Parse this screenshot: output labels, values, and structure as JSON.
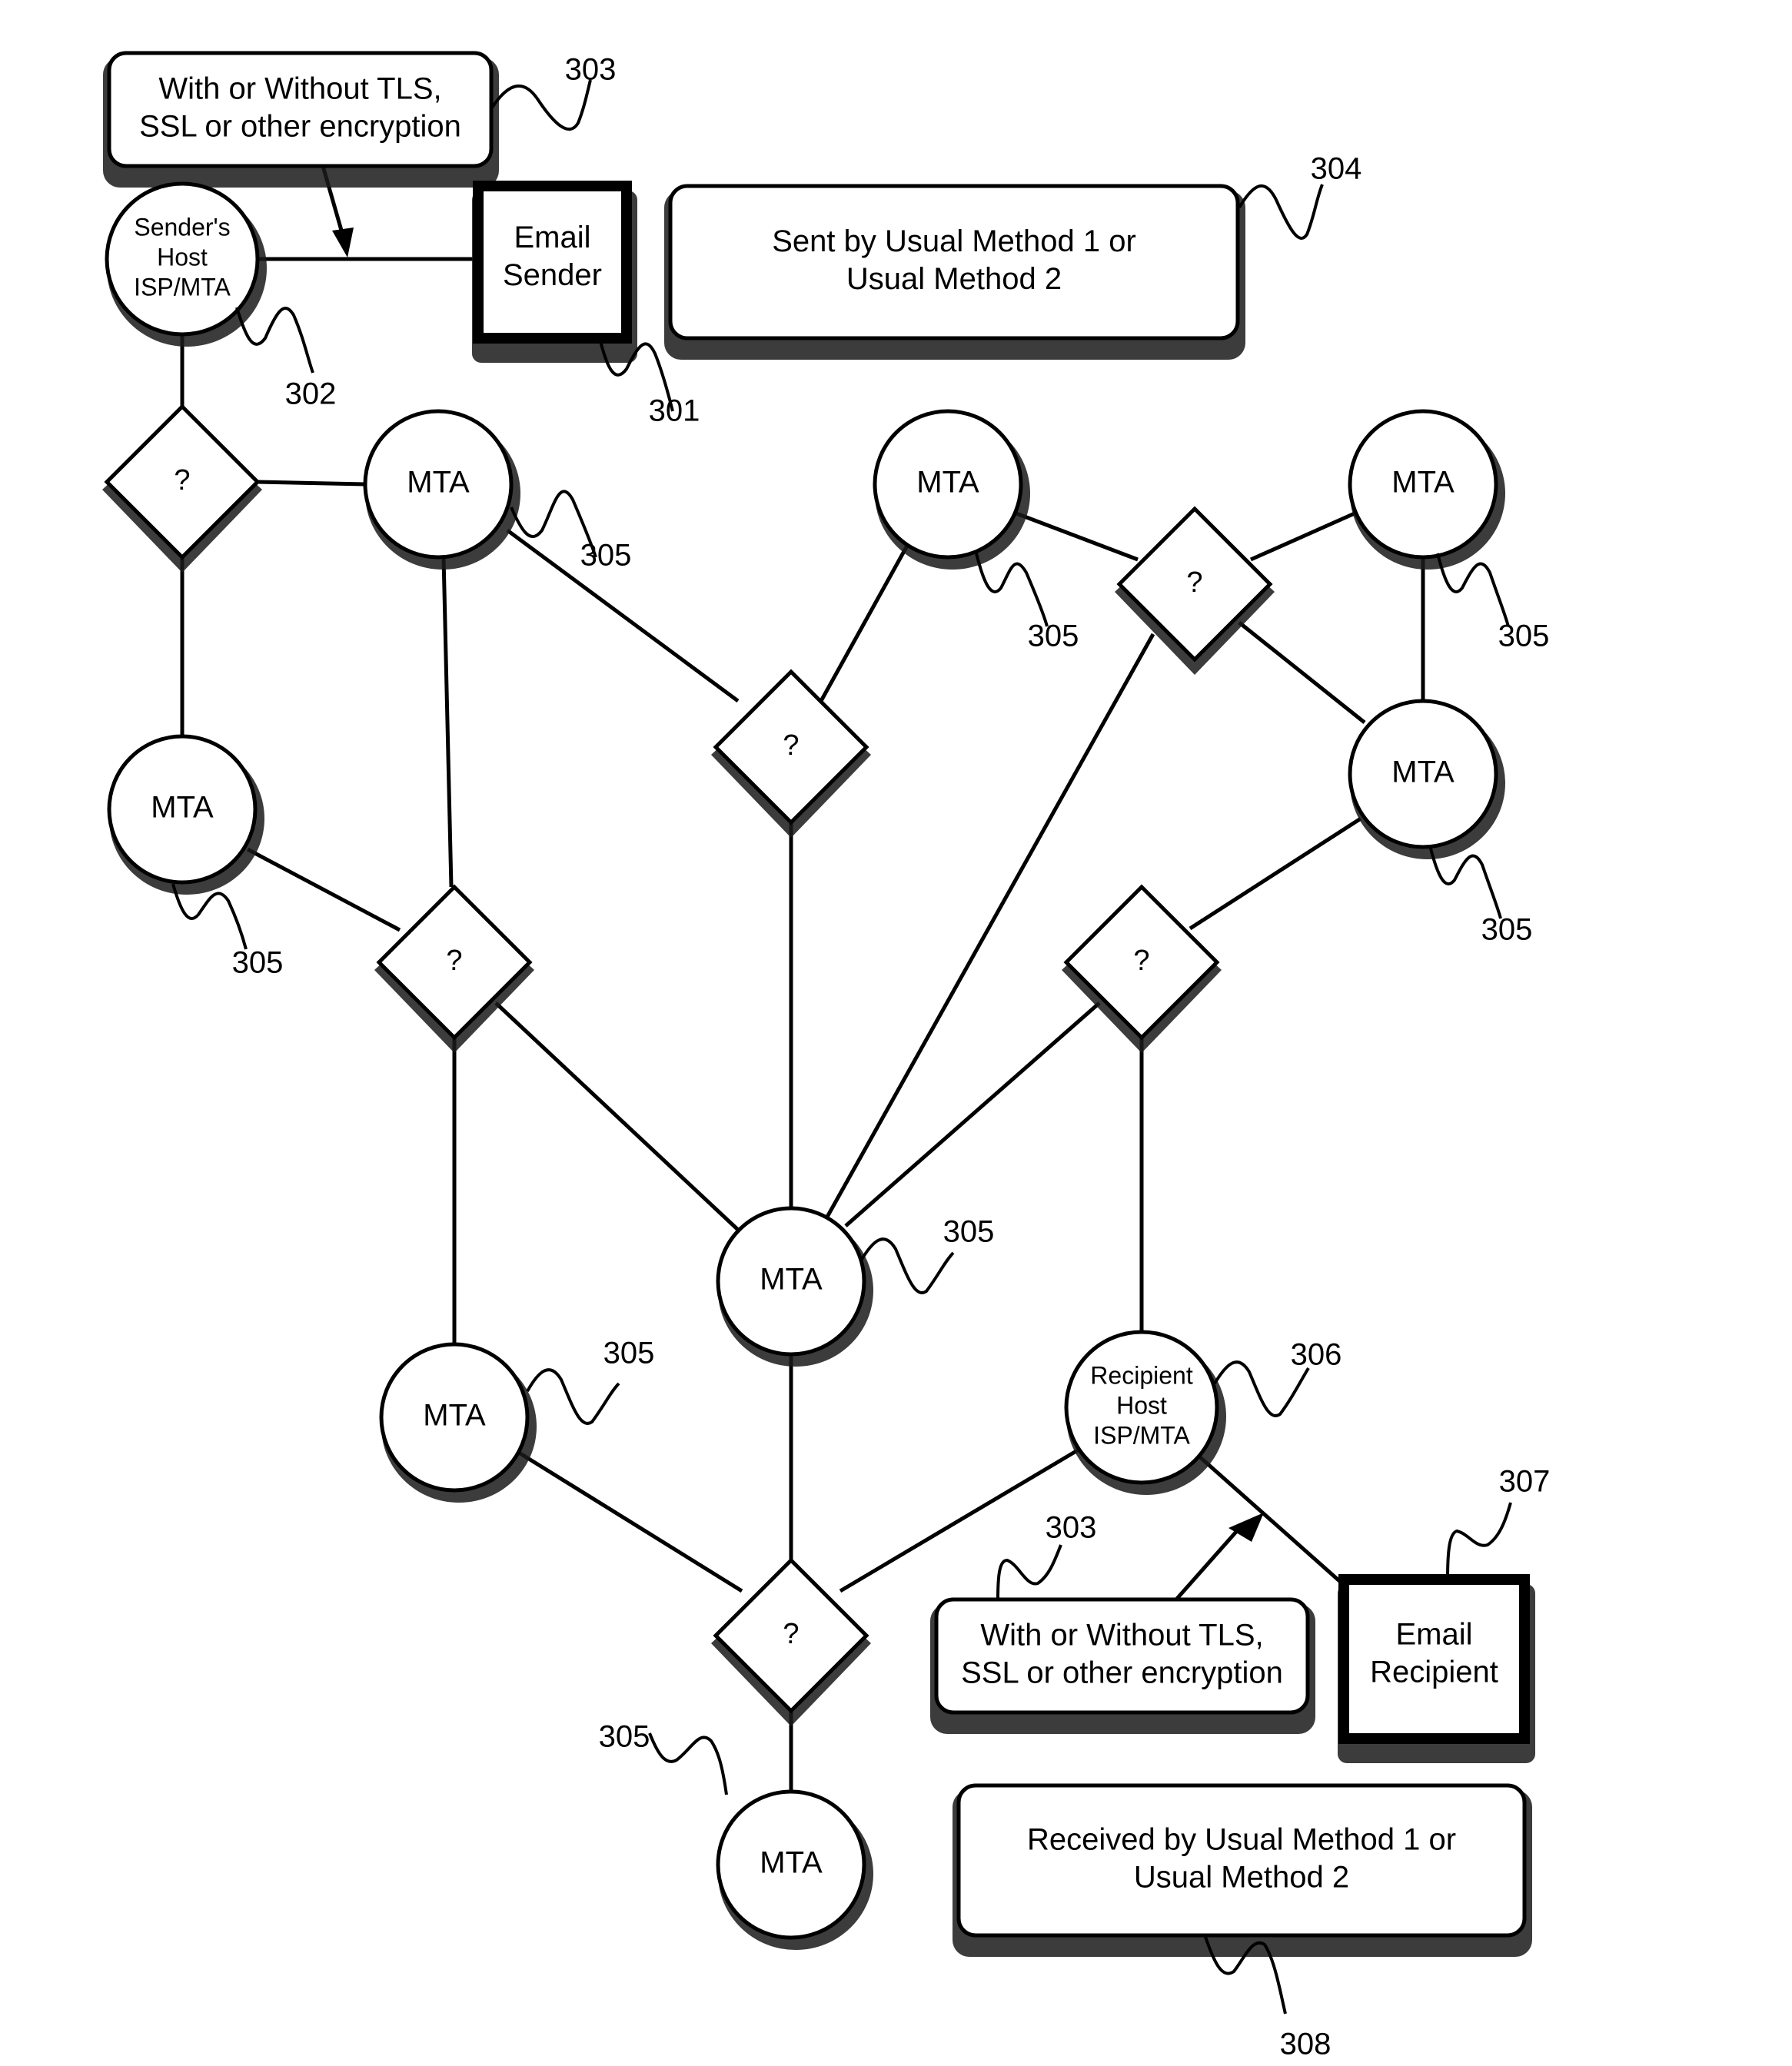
{
  "figure": {
    "nodes": {
      "encryption_top": {
        "lines": [
          "With or Without TLS,",
          "SSL or other encryption"
        ],
        "ref": "303"
      },
      "sender_host": {
        "lines": [
          "Sender's",
          "Host",
          "ISP/MTA"
        ],
        "ref": "302"
      },
      "email_sender": {
        "lines": [
          "Email",
          "Sender"
        ],
        "ref": "301"
      },
      "sent_method": {
        "lines": [
          "Sent by Usual Method 1 or",
          "Usual Method 2"
        ],
        "ref": "304"
      },
      "decision_1": {
        "label": "?"
      },
      "mta_1": {
        "label": "MTA",
        "ref": "305"
      },
      "mta_2": {
        "label": "MTA",
        "ref": "305"
      },
      "mta_3": {
        "label": "MTA",
        "ref": "305"
      },
      "decision_2": {
        "label": "?"
      },
      "decision_3": {
        "label": "?"
      },
      "mta_4": {
        "label": "MTA",
        "ref": "305"
      },
      "mta_5": {
        "label": "MTA",
        "ref": "305"
      },
      "decision_4": {
        "label": "?"
      },
      "decision_5": {
        "label": "?"
      },
      "mta_center": {
        "label": "MTA",
        "ref": "305"
      },
      "mta_6": {
        "label": "MTA",
        "ref": "305"
      },
      "recipient_host": {
        "lines": [
          "Recipient",
          "Host",
          "ISP/MTA"
        ],
        "ref": "306"
      },
      "decision_6": {
        "label": "?"
      },
      "mta_bottom": {
        "label": "MTA",
        "ref": "305"
      },
      "encryption_bottom": {
        "lines": [
          "With or Without TLS,",
          "SSL or other encryption"
        ],
        "ref": "303"
      },
      "email_recipient": {
        "lines": [
          "Email",
          "Recipient"
        ],
        "ref": "307"
      },
      "received_method": {
        "lines": [
          "Received by Usual Method 1 or",
          "Usual Method 2"
        ],
        "ref": "308"
      }
    }
  }
}
